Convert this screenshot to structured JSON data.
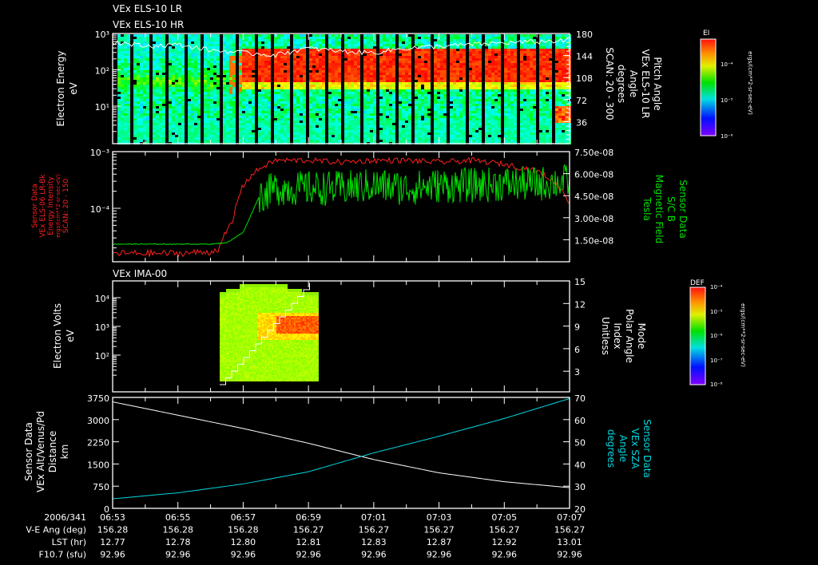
{
  "titles": {
    "panel1_line1": "VEx ELS-10 LR",
    "panel1_line2": "VEx ELS-10 HR",
    "panel3": "VEx IMA-00"
  },
  "colors": {
    "intensity": "#ff2020",
    "bfield": "#00e000",
    "sza": "#00d8e0",
    "axis": "#ffffff",
    "background": "#000000"
  },
  "colorbars": [
    {
      "title": "EI",
      "ticks": [
        "10⁻⁴",
        "10⁻⁵",
        "10⁻⁶"
      ],
      "unit": "ergs/(cm**2-sr-sec-eV)"
    },
    {
      "title": "DEF",
      "ticks": [
        "10⁻⁴",
        "10⁻⁵",
        "10⁻⁶",
        "10⁻⁷",
        "10⁻⁸"
      ],
      "unit": "ergs/(cm**2-sr-sec-eV)"
    }
  ],
  "footer": {
    "rows": [
      {
        "label": "2006/341",
        "values": [
          "06:53",
          "06:55",
          "06:57",
          "06:59",
          "07:01",
          "07:03",
          "07:05",
          "07:07"
        ]
      },
      {
        "label": "V-E Ang (deg)",
        "values": [
          "156.28",
          "156.28",
          "156.28",
          "156.27",
          "156.27",
          "156.27",
          "156.27",
          "156.27"
        ]
      },
      {
        "label": "LST (hr)",
        "values": [
          "12.77",
          "12.78",
          "12.80",
          "12.81",
          "12.83",
          "12.87",
          "12.92",
          "13.01"
        ]
      },
      {
        "label": "F10.7 (sfu)",
        "values": [
          "92.96",
          "92.96",
          "92.96",
          "92.96",
          "92.96",
          "92.96",
          "92.96",
          "92.96"
        ]
      }
    ]
  },
  "chart_data": [
    {
      "type": "heatmap",
      "title": "VEx ELS-10 LR / VEx ELS-10 HR",
      "xlabel": "",
      "xlim": [
        "06:53",
        "07:07"
      ],
      "ylabel": [
        "Electron Energy",
        "eV"
      ],
      "yticks": [
        "10³",
        "10²",
        "10¹"
      ],
      "yscale": "log",
      "ylim": [
        1,
        1000
      ],
      "y2label": [
        "Pitch Angle",
        "VEx ELS-10 LR",
        "Angle",
        "degrees",
        "SCAN: 20 - 300"
      ],
      "y2ticks": [
        "180",
        "144",
        "108",
        "72",
        "36"
      ],
      "y2lim": [
        0,
        180
      ],
      "description_values": {
        "red_band_eV": [
          40,
          300
        ],
        "red_band_start": "06:57:00"
      },
      "overlay_line": {
        "minutes": [
          0,
          1,
          2,
          3,
          4,
          5,
          6,
          7,
          8,
          9,
          10,
          11,
          12,
          13,
          14
        ],
        "values_eV": [
          600,
          450,
          500,
          350,
          300,
          260,
          400,
          330,
          300,
          400,
          450,
          500,
          560,
          600,
          650
        ]
      }
    },
    {
      "type": "line",
      "xlim": [
        "06:53",
        "07:07"
      ],
      "ylabel": [
        "Sensor Data",
        "VEx ELS-06 LR-Bk",
        "Energy Intensity",
        "ergs/(cm**2-sr-sec-eV)",
        "SCAN: 20 - 150"
      ],
      "yticks": [
        "10⁻³",
        "10⁻⁴"
      ],
      "yscale": "log",
      "y2label": [
        "Sensor Data",
        "S/C B",
        "Magnetic Field",
        "Tesla"
      ],
      "y2ticks": [
        "7.50e-08",
        "6.00e-08",
        "4.50e-08",
        "3.00e-08",
        "1.50e-08"
      ],
      "y2lim": [
        0,
        7.5e-08
      ],
      "series": [
        {
          "name": "Energy Intensity",
          "axis": "left",
          "minutes": [
            0,
            1,
            2,
            3,
            3.3,
            3.7,
            4,
            4.5,
            5,
            6,
            7,
            8,
            9,
            10,
            11,
            12,
            13,
            13.5,
            14
          ],
          "values": [
            1.6e-05,
            1.6e-05,
            1.6e-05,
            1.7e-05,
            2e-05,
            6e-05,
            0.00025,
            0.0005,
            0.0007,
            0.0007,
            0.00065,
            0.0007,
            0.0007,
            0.00065,
            0.0007,
            0.0006,
            0.00045,
            0.0003,
            0.00012
          ]
        },
        {
          "name": "S/C B",
          "axis": "right",
          "minutes": [
            0,
            1,
            2,
            3,
            3.5,
            4,
            4.5,
            5,
            6,
            7,
            8,
            9,
            10,
            11,
            12,
            13,
            14
          ],
          "values": [
            1.2e-08,
            1.2e-08,
            1.2e-08,
            1.2e-08,
            1.3e-08,
            2e-08,
            4.5e-08,
            5e-08,
            5e-08,
            5e-08,
            5.2e-08,
            5e-08,
            5.2e-08,
            5.2e-08,
            5.3e-08,
            5.3e-08,
            5.5e-08
          ]
        }
      ]
    },
    {
      "type": "heatmap",
      "title": "VEx IMA-00",
      "xlim": [
        "06:53",
        "07:07"
      ],
      "ylabel": [
        "Electron Volts",
        "eV"
      ],
      "yscale": "log",
      "yticks": [
        "10⁴",
        "10³",
        "10²"
      ],
      "y2label": [
        "Mode",
        "Polar Angle",
        "Index",
        "Unitless"
      ],
      "y2ticks": [
        "15",
        "12",
        "9",
        "6",
        "3"
      ],
      "y2lim": [
        1.5,
        15
      ],
      "data_window": [
        "06:56:18",
        "06:59:18"
      ],
      "overlay_line": {
        "name": "Polar Angle Index",
        "values_start": 1,
        "values_end": 15
      }
    },
    {
      "type": "line",
      "xlim": [
        "06:53",
        "07:07"
      ],
      "ylabel": [
        "Sensor Data",
        "VEx Alt/Venus/Pd",
        "Distance",
        "km"
      ],
      "yticks": [
        "3750",
        "3000",
        "2250",
        "1500",
        "750",
        "0"
      ],
      "ylim": [
        0,
        3750
      ],
      "y2label": [
        "Sensor Data",
        "VEx SZA",
        "Angle",
        "degrees"
      ],
      "y2ticks": [
        "70",
        "60",
        "50",
        "40",
        "30",
        "20"
      ],
      "y2lim": [
        20,
        70
      ],
      "series": [
        {
          "name": "VEx Alt/Venus/Pd",
          "axis": "left",
          "minutes": [
            0,
            2,
            4,
            6,
            8,
            10,
            12,
            14
          ],
          "values": [
            3600,
            3150,
            2700,
            2200,
            1650,
            1200,
            900,
            700
          ]
        },
        {
          "name": "VEx SZA",
          "axis": "right",
          "minutes": [
            0,
            2,
            4,
            6,
            8,
            10,
            12,
            14
          ],
          "values": [
            24.3,
            27,
            31,
            36.5,
            45,
            52.5,
            60.5,
            69.5
          ]
        }
      ]
    }
  ]
}
